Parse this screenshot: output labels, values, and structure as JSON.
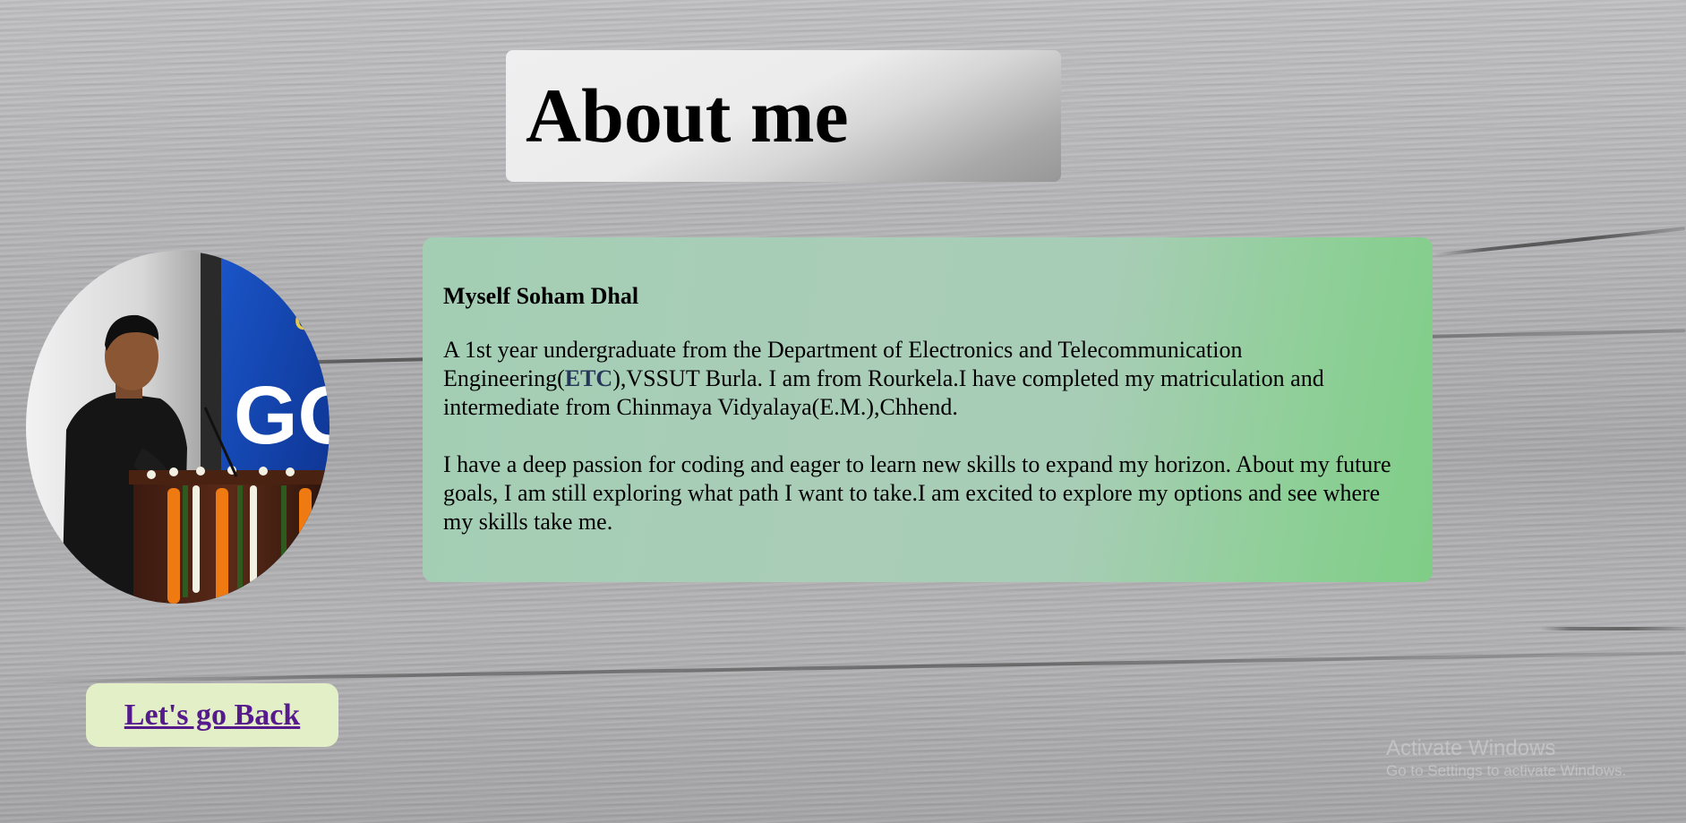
{
  "header": {
    "title": "About me"
  },
  "profile": {
    "alt": "Soham Dhal speaking at a podium",
    "banner_text_1": "GOL",
    "banner_text_2": "CE"
  },
  "about": {
    "name": "Myself Soham Dhal",
    "para1_before": "A 1st year undergraduate from the Department of Electronics and Telecommunication Engineering(",
    "para1_highlight": "ETC",
    "para1_after": "),VSSUT Burla. I am from Rourkela.I have completed my matriculation and intermediate from Chinmaya Vidyalaya(E.M.),Chhend.",
    "para2": "I have a deep passion for coding and eager to learn new skills to expand my horizon. About my future goals, I am still exploring what path I want to take.I am excited to explore my options and see where my skills take me."
  },
  "nav": {
    "back_label": "Let's go Back"
  },
  "watermark": {
    "title": "Activate Windows",
    "subtitle": "Go to Settings to activate Windows."
  },
  "colors": {
    "link": "#551a8b",
    "highlight": "#263859",
    "button_bg": "#e3efc6"
  }
}
